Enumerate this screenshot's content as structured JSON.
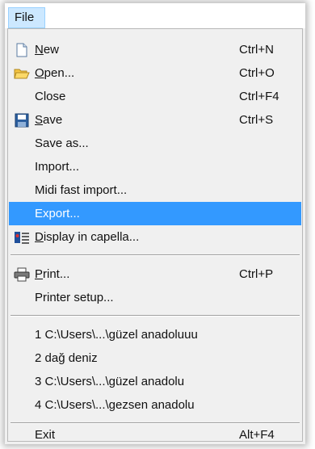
{
  "menubar": {
    "file_label": "File"
  },
  "menu": {
    "new": {
      "label_u": "N",
      "label_rest": "ew",
      "shortcut": "Ctrl+N",
      "icon": "new-document-icon"
    },
    "open": {
      "label_u": "O",
      "label_rest": "pen...",
      "shortcut": "Ctrl+O",
      "icon": "folder-open-icon"
    },
    "close": {
      "label": "Close",
      "shortcut": "Ctrl+F4"
    },
    "save": {
      "label_u": "S",
      "label_rest": "ave",
      "shortcut": "Ctrl+S",
      "icon": "floppy-disk-icon"
    },
    "save_as": {
      "label": "Save as..."
    },
    "import": {
      "label": "Import..."
    },
    "midi_import": {
      "label": "Midi fast import..."
    },
    "export": {
      "label": "Export..."
    },
    "display_capella": {
      "label_u": "D",
      "label_rest": "isplay in capella...",
      "icon": "capella-icon"
    },
    "print": {
      "label_u": "P",
      "label_rest": "rint...",
      "shortcut": "Ctrl+P",
      "icon": "printer-icon"
    },
    "printer_setup": {
      "label": "Printer setup..."
    },
    "recent": [
      "1 C:\\Users\\...\\güzel anadoluuu",
      "2 dağ deniz",
      "3 C:\\Users\\...\\güzel anadolu",
      "4 C:\\Users\\...\\gezsen anadolu"
    ],
    "exit": {
      "label": "Exit",
      "shortcut": "Alt+F4"
    }
  },
  "colors": {
    "highlight": "#3399ff",
    "menu_bg": "#f0f0f0",
    "menubar_active": "#cce8ff"
  }
}
